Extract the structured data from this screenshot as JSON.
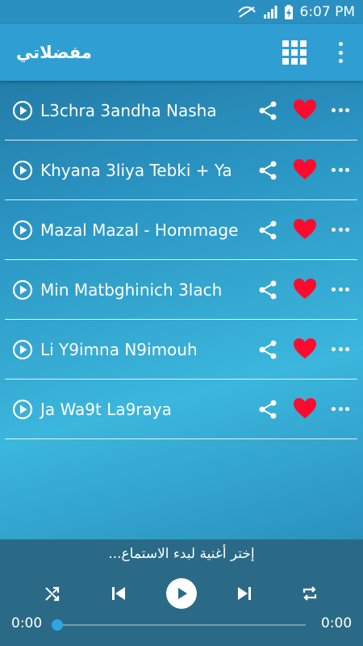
{
  "status_bar": {
    "time": "6:07 PM"
  },
  "app_bar": {
    "title": "مفضلاتي",
    "icons": [
      "grid-icon",
      "more-vert-icon"
    ]
  },
  "songs": [
    {
      "title": "L3chra 3andha Nasha"
    },
    {
      "title": "Khyana 3liya Tebki + Ya"
    },
    {
      "title": "Mazal Mazal - Hommage"
    },
    {
      "title": "Min Matbghinich 3lach"
    },
    {
      "title": "Li Y9imna N9imouh"
    },
    {
      "title": "Ja Wa9t La9raya"
    }
  ],
  "player": {
    "hint": "إختر أغنية لبدء الاستماع...",
    "current_time": "0:00",
    "total_time": "0:00",
    "progress": 0
  },
  "colors": {
    "app_bar": "#2f9fd3",
    "heart": "#ff0a2e",
    "player_bg": "#2a6a86",
    "seek_thumb": "#2fa6e0"
  }
}
